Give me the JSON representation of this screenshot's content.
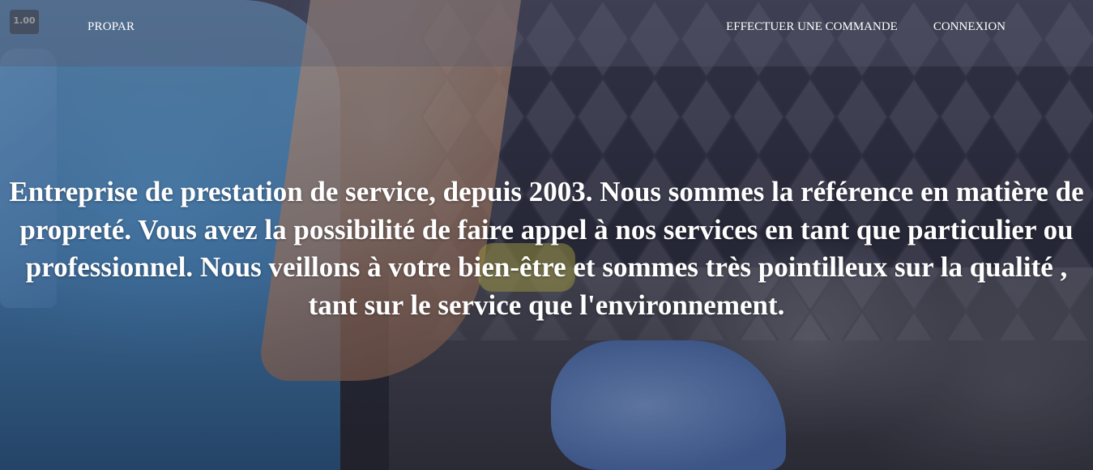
{
  "viewer": {
    "zoom_level": "1.00"
  },
  "navbar": {
    "brand": "PROPAR",
    "links": [
      {
        "label": "EFFECTUER UNE COMMANDE"
      },
      {
        "label": "CONNEXION"
      }
    ]
  },
  "hero": {
    "text": "Entreprise de prestation de service, depuis 2003. Nous sommes la référence en matière de propreté. Vous avez la possibilité de faire appel à nos services en tant que particulier ou professionnel. Nous veillons à votre bien-être et sommes très pointilleux sur la qualité , tant sur le service que l'environnement."
  },
  "colors": {
    "text": "#ffffff",
    "navbar_bg": "rgba(90,90,110,0.35)"
  }
}
